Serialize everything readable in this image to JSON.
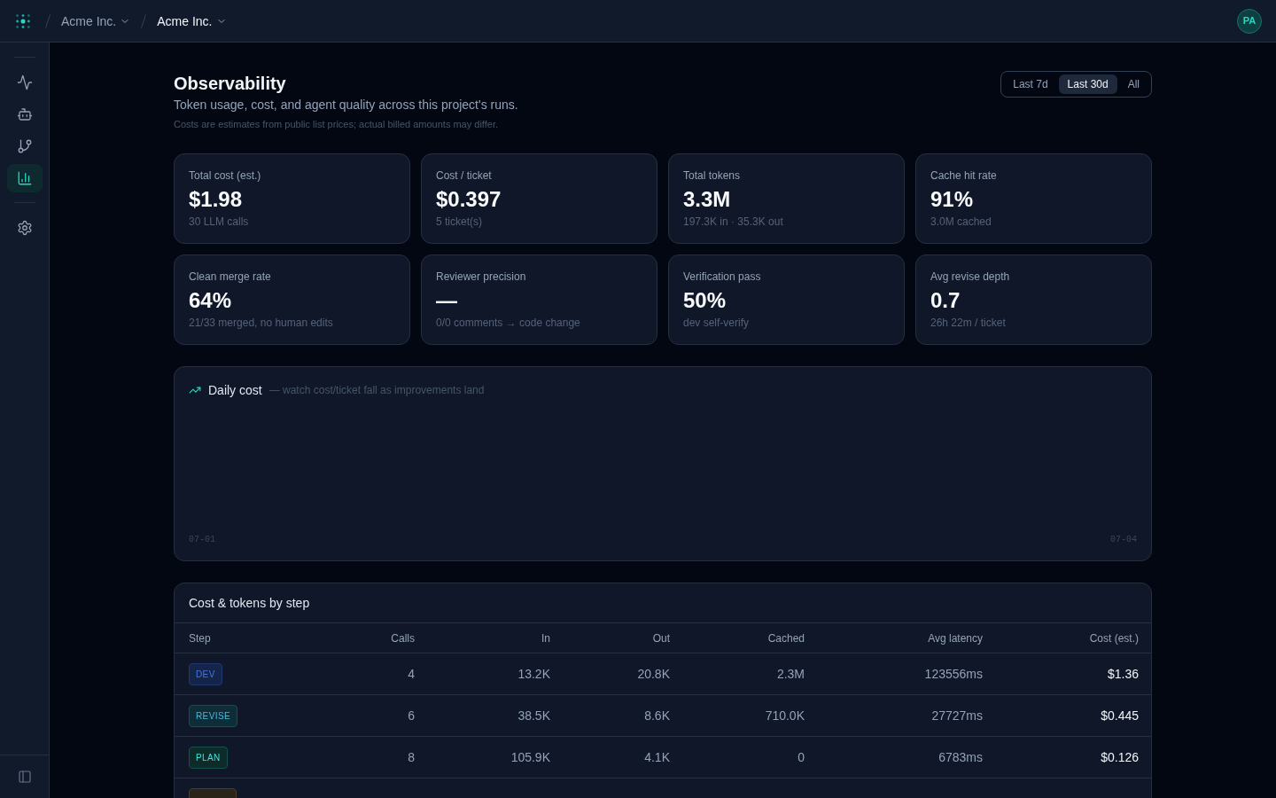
{
  "top_bar": {
    "breadcrumbs": [
      {
        "label": "Acme Inc.",
        "current": false
      },
      {
        "label": "Acme Inc.",
        "current": true
      }
    ],
    "avatar": {
      "initials": "PA"
    }
  },
  "sidebar": {
    "items": [
      {
        "selected": false
      },
      {
        "selected": false
      },
      {
        "selected": false
      },
      {
        "selected": true
      }
    ],
    "settings": {
      "selected": false
    }
  },
  "header": {
    "title": "Observability",
    "subtitle": "Token usage, cost, and agent quality across this project's runs.",
    "note": "Costs are estimates from public list prices; actual billed amounts may differ."
  },
  "time_range": [
    {
      "label": "Last 7d",
      "selected": false
    },
    {
      "label": "Last 30d",
      "selected": true
    },
    {
      "label": "All",
      "selected": false
    }
  ],
  "metrics": [
    {
      "label": "Total cost (est.)",
      "value": "$1.98",
      "detail": "30 LLM calls"
    },
    {
      "label": "Cost / ticket",
      "value": "$0.397",
      "detail": "5 ticket(s)"
    },
    {
      "label": "Total tokens",
      "value": "3.3M",
      "detail": "197.3K in · 35.3K out"
    },
    {
      "label": "Cache hit rate",
      "value": "91%",
      "detail": "3.0M cached"
    },
    {
      "label": "Clean merge rate",
      "value": "64%",
      "detail": "21/33 merged, no human edits"
    },
    {
      "label": "Reviewer precision",
      "value": "—",
      "detail": "0/0 comments → code change"
    },
    {
      "label": "Verification pass",
      "value": "50%",
      "detail": "dev self-verify"
    },
    {
      "label": "Avg revise depth",
      "value": "0.7",
      "detail": "26h 22m / ticket"
    }
  ],
  "daily_cost": {
    "title": "Daily cost",
    "subtitle": "— watch cost/ticket fall as improvements land",
    "x_labels": [
      "07-01",
      "07-04"
    ]
  },
  "steps_table": {
    "title": "Cost & tokens by step",
    "columns": [
      "Step",
      "Calls",
      "In",
      "Out",
      "Cached",
      "Avg latency",
      "Cost (est.)"
    ],
    "rows": [
      {
        "step": "DEV",
        "color": "#15254a",
        "cells": [
          "4",
          "13.2K",
          "20.8K",
          "2.3M",
          "123556ms",
          "$1.36"
        ]
      },
      {
        "step": "REVISE",
        "color": "#0d2d39",
        "cells": [
          "6",
          "38.5K",
          "8.6K",
          "710.0K",
          "27727ms",
          "$0.445"
        ]
      },
      {
        "step": "PLAN",
        "color": "#0c2b29",
        "cells": [
          "8",
          "105.9K",
          "4.1K",
          "0",
          "6783ms",
          "$0.126"
        ]
      },
      {
        "color": "#2a2418"
      }
    ]
  }
}
